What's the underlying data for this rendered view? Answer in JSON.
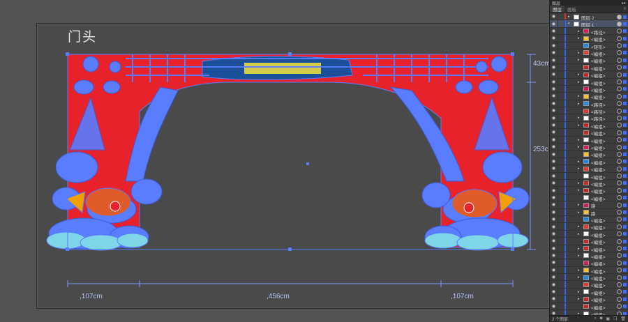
{
  "artboard": {
    "title": "门头"
  },
  "dimensions": {
    "left_width": ",107cm",
    "center_width": ",456cm",
    "right_width": ",107cm",
    "top_height": "43cm",
    "side_height": "253c"
  },
  "colors": {
    "background": "#535353",
    "gate_red": "#e8222b",
    "outline_blue": "#5a7cff",
    "panel_bg": "#3c3c3c"
  },
  "panel": {
    "title": "图层",
    "tabs": [
      "图层",
      "画板"
    ],
    "menu_icon": "panel-menu-icon",
    "layers": [
      {
        "name": "图层 2",
        "level": 0,
        "expanded": false,
        "selected": false
      },
      {
        "name": "图层 1",
        "level": 0,
        "expanded": true,
        "selected": true
      },
      {
        "name": "<路径>",
        "level": 1
      },
      {
        "name": "<编组>",
        "level": 1
      },
      {
        "name": "<矩形>",
        "level": 1
      },
      {
        "name": "<编组>",
        "level": 1
      },
      {
        "name": "<编组>",
        "level": 1
      },
      {
        "name": "<编组>",
        "level": 1
      },
      {
        "name": "<编组>",
        "level": 1
      },
      {
        "name": "<编组>",
        "level": 1
      },
      {
        "name": "<编组>",
        "level": 1
      },
      {
        "name": "<编组>",
        "level": 1
      },
      {
        "name": "<路径>",
        "level": 1
      },
      {
        "name": "<路径>",
        "level": 1
      },
      {
        "name": "<路径>",
        "level": 1
      },
      {
        "name": "<编组>",
        "level": 1
      },
      {
        "name": "<编组>",
        "level": 1
      },
      {
        "name": "<编组>",
        "level": 1
      },
      {
        "name": "<编组>",
        "level": 1
      },
      {
        "name": "<编组>",
        "level": 1
      },
      {
        "name": "<编组>",
        "level": 1
      },
      {
        "name": "<编组>",
        "level": 1
      },
      {
        "name": "<编组>",
        "level": 1
      },
      {
        "name": "<编组>",
        "level": 1
      },
      {
        "name": "<编组>",
        "level": 1
      },
      {
        "name": "<编组>",
        "level": 1
      },
      {
        "name": "路",
        "level": 1
      },
      {
        "name": "路",
        "level": 1
      },
      {
        "name": "<编组>",
        "level": 1
      },
      {
        "name": "<编组>",
        "level": 1
      },
      {
        "name": "<编组>",
        "level": 1
      },
      {
        "name": "<编组>",
        "level": 1
      },
      {
        "name": "<编组>",
        "level": 1
      },
      {
        "name": "<编组>",
        "level": 1
      },
      {
        "name": "<编组>",
        "level": 1
      },
      {
        "name": "<编组>",
        "level": 1
      },
      {
        "name": "<编组>",
        "level": 1
      },
      {
        "name": "<编组>",
        "level": 1
      },
      {
        "name": "<编组>",
        "level": 1
      },
      {
        "name": "<编组>",
        "level": 1
      },
      {
        "name": "<编组>",
        "level": 1
      },
      {
        "name": "<编组>",
        "level": 1
      }
    ],
    "footer": {
      "count_label": "2 个图层"
    }
  }
}
